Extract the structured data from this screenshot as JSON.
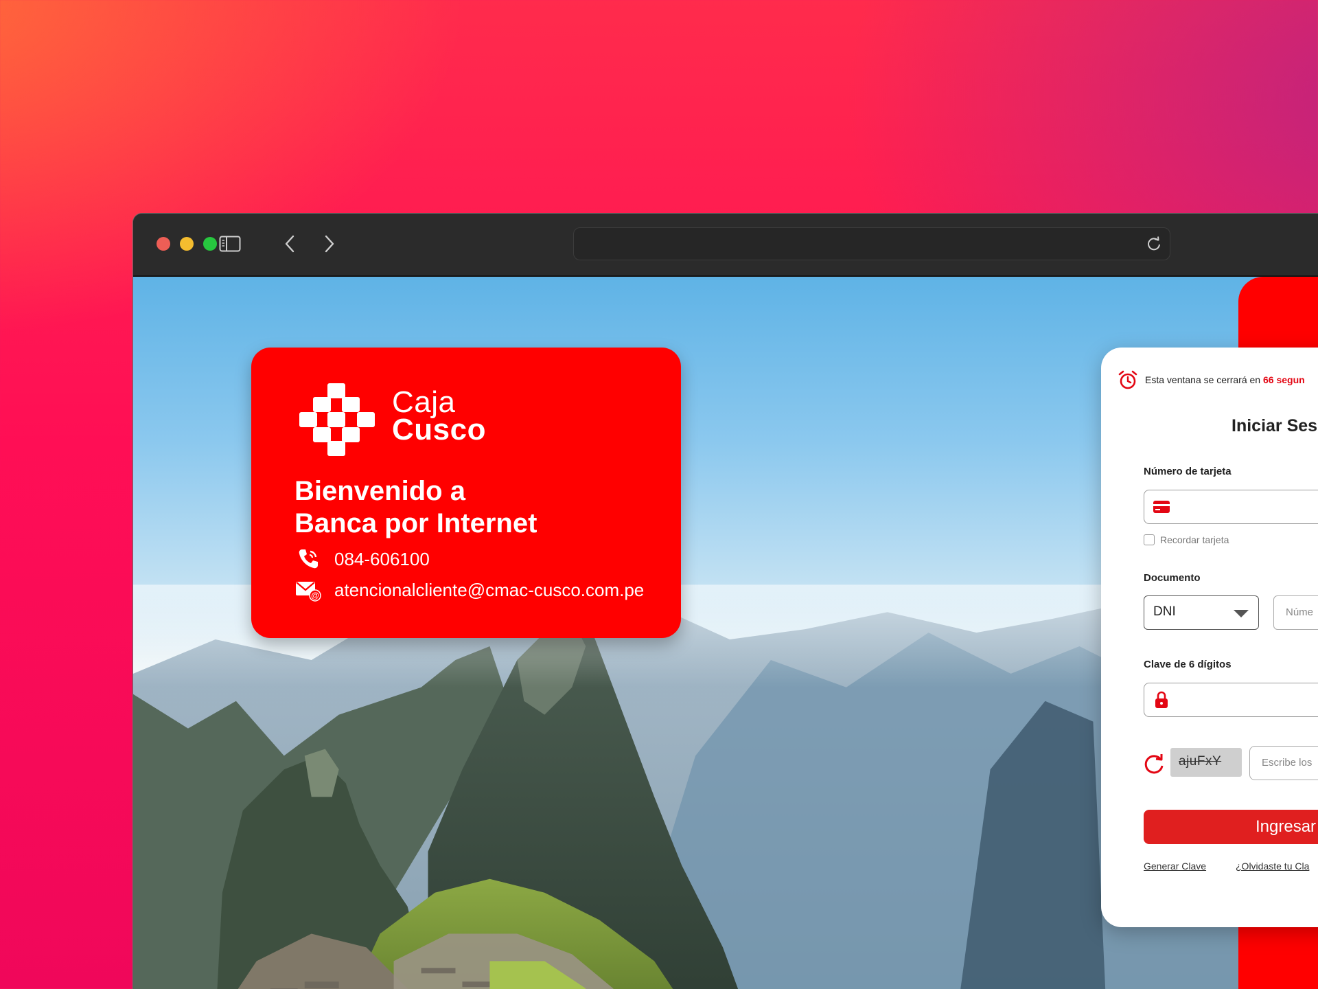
{
  "browser": {
    "url_text": "",
    "controls": {
      "sidebar": "sidebar-toggle-icon",
      "back": "chevron-left-icon",
      "forward": "chevron-right-icon",
      "reload": "reload-icon"
    }
  },
  "welcome_card": {
    "brand_line1": "Caja",
    "brand_line2": "Cusco",
    "title_line1": "Bienvenido a",
    "title_line2": "Banca por Internet",
    "phone": "084-606100",
    "email": "atencionalcliente@cmac-cusco.com.pe"
  },
  "login": {
    "timer_prefix": "Esta ventana se cerrará en",
    "timer_value": "66 segun",
    "title": "Iniciar Ses",
    "card_label": "Número de tarjeta",
    "card_value": "",
    "remember_label": "Recordar tarjeta",
    "document_label": "Documento",
    "document_type": "DNI",
    "document_number_placeholder": "Núme",
    "password_label": "Clave de 6 dígitos",
    "password_value": "",
    "captcha_text": "ajuFxY",
    "captcha_placeholder": "Escribe los",
    "submit_label": "Ingresar",
    "link_generate": "Generar Clave",
    "link_forgot": "¿Olvidaste tu Cla"
  },
  "colors": {
    "brand_red": "#ff0000",
    "button_red": "#e01f1f",
    "accent_red": "#e30613"
  }
}
